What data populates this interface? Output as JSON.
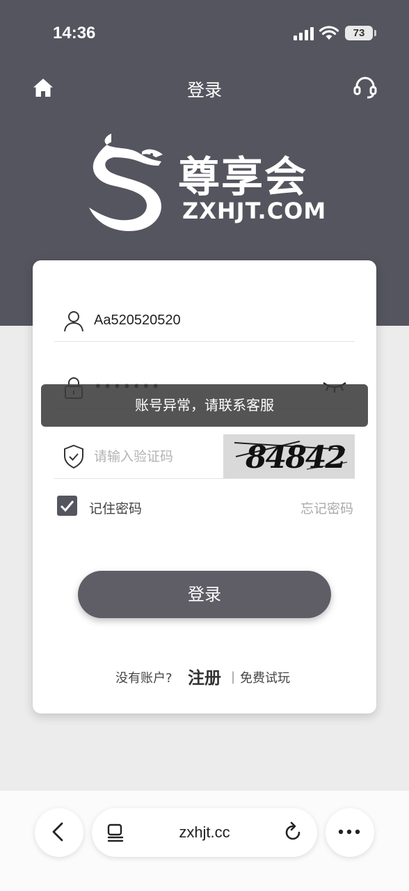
{
  "status_bar": {
    "time": "14:36",
    "battery": "73"
  },
  "header": {
    "title": "登录"
  },
  "logo": {
    "name": "尊享会",
    "domain": "ZXHJT.COM"
  },
  "form": {
    "username_value": "Aa520520520",
    "password_masked": "•••••••",
    "captcha_placeholder": "请输入验证码",
    "captcha_code": "84842",
    "remember_label": "记住密码",
    "remember_checked": true,
    "forgot_label": "忘记密码",
    "login_button": "登录",
    "no_account_text": "没有账户?",
    "register_label": "注册",
    "divider": "|",
    "trial_label": "免费试玩"
  },
  "toast": {
    "message": "账号异常，请联系客服"
  },
  "browser": {
    "url": "zxhjt.cc"
  },
  "colors": {
    "header_bg": "#55555f",
    "button_bg": "#5f5e66",
    "page_bg": "#ececec"
  }
}
